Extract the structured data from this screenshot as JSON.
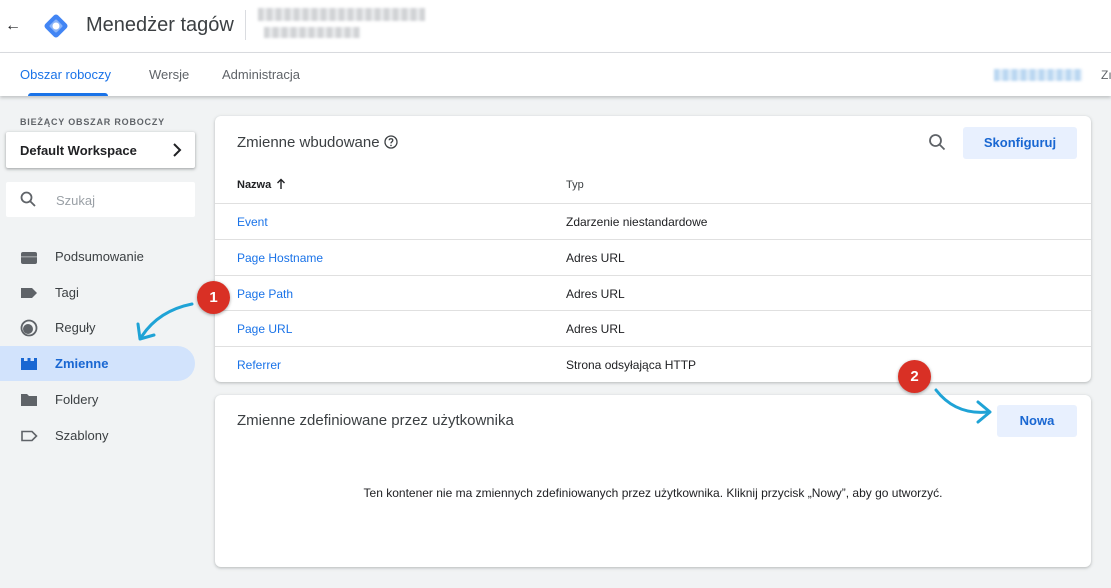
{
  "header": {
    "app_title": "Menedżer tagów",
    "back_icon": "arrow-left-icon",
    "logo_icon": "tag-manager-logo"
  },
  "tabs": [
    {
      "label": "Obszar roboczy",
      "active": true
    },
    {
      "label": "Wersje",
      "active": false
    },
    {
      "label": "Administracja",
      "active": false
    }
  ],
  "tabs_right_text": "Zı",
  "sidebar": {
    "workspace_label": "BIEŻĄCY OBSZAR ROBOCZY",
    "workspace_name": "Default Workspace",
    "search_placeholder": "Szukaj",
    "items": [
      {
        "label": "Podsumowanie",
        "icon": "briefcase-icon",
        "active": false
      },
      {
        "label": "Tagi",
        "icon": "tag-icon",
        "active": false
      },
      {
        "label": "Reguły",
        "icon": "trigger-icon",
        "active": false
      },
      {
        "label": "Zmienne",
        "icon": "variables-icon",
        "active": true
      },
      {
        "label": "Foldery",
        "icon": "folder-icon",
        "active": false
      },
      {
        "label": "Szablony",
        "icon": "label-outline-icon",
        "active": false
      }
    ]
  },
  "builtin": {
    "title": "Zmienne wbudowane",
    "configure_label": "Skonfiguruj",
    "columns": {
      "name": "Nazwa",
      "type": "Typ"
    },
    "rows": [
      {
        "name": "Event",
        "type": "Zdarzenie niestandardowe"
      },
      {
        "name": "Page Hostname",
        "type": "Adres URL"
      },
      {
        "name": "Page Path",
        "type": "Adres URL"
      },
      {
        "name": "Page URL",
        "type": "Adres URL"
      },
      {
        "name": "Referrer",
        "type": "Strona odsyłająca HTTP"
      }
    ]
  },
  "user_defined": {
    "title": "Zmienne zdefiniowane przez użytkownika",
    "new_label": "Nowa",
    "empty_message": "Ten kontener nie ma zmiennych zdefiniowanych przez użytkownika. Kliknij przycisk „Nowy”, aby go utworzyć."
  },
  "annotations": {
    "badge_1": "1",
    "badge_2": "2",
    "badge_color": "#d93025",
    "arrow_color": "#1fa3d6"
  },
  "colors": {
    "accent": "#1a73e8",
    "active_nav_bg": "#d2e3fc",
    "button_bg": "#e8f0fe",
    "page_bg": "#f1f3f4"
  }
}
